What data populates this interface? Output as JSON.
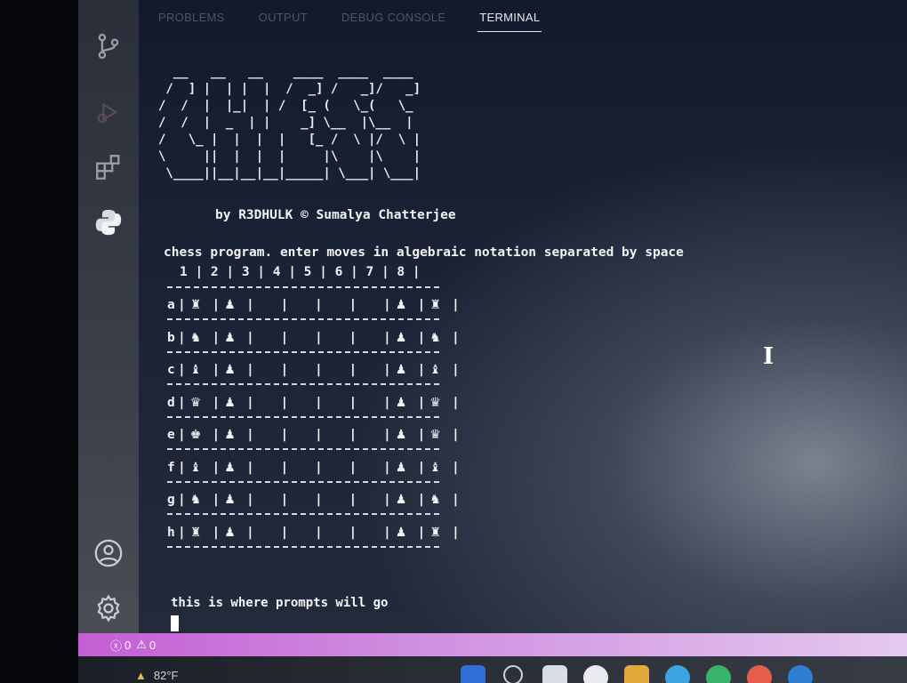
{
  "panel": {
    "tabs": [
      {
        "label": "PROBLEMS",
        "active": false
      },
      {
        "label": "OUTPUT",
        "active": false
      },
      {
        "label": "DEBUG CONSOLE",
        "active": false
      },
      {
        "label": "TERMINAL",
        "active": true
      }
    ]
  },
  "activity_bar": {
    "icons": [
      "source-control-icon",
      "run-debug-icon",
      "extensions-icon",
      "python-icon",
      "account-icon",
      "settings-gear-icon"
    ]
  },
  "terminal": {
    "ascii_logo": "  __   __   __    ____  ____  ____\n /  ] |  | |  |  /  _] /   _]/   _]\n/  /  |  |_|  | /  [_ (   \\_(   \\_\n/  /  |  _  | |    _] \\__  |\\__  |\n/   \\_ |  |  |  |   [_ /  \\ |/  \\ |\n\\     ||  |  |  |     |\\    |\\    |\n \\____||__|__|__|_____| \\___| \\___|",
    "credit": "by R3DHULK © Sumalya Chatterjee",
    "intro": "chess program. enter moves in algebraic notation separated by space",
    "header": "1 | 2 | 3 | 4 | 5 | 6 | 7 | 8 |",
    "separator": "---------------------------------",
    "rows": [
      {
        "label": "a",
        "cells": [
          "♜",
          "♟",
          "",
          "",
          "",
          "",
          "♟",
          "♜"
        ]
      },
      {
        "label": "b",
        "cells": [
          "♞",
          "♟",
          "",
          "",
          "",
          "",
          "♟",
          "♞"
        ]
      },
      {
        "label": "c",
        "cells": [
          "♝",
          "♟",
          "",
          "",
          "",
          "",
          "♟",
          "♝"
        ]
      },
      {
        "label": "d",
        "cells": [
          "♛",
          "♟",
          "",
          "",
          "",
          "",
          "♟",
          "♛"
        ]
      },
      {
        "label": "e",
        "cells": [
          "♚",
          "♟",
          "",
          "",
          "",
          "",
          "♟",
          "♛"
        ]
      },
      {
        "label": "f",
        "cells": [
          "♝",
          "♟",
          "",
          "",
          "",
          "",
          "♟",
          "♝"
        ]
      },
      {
        "label": "g",
        "cells": [
          "♞",
          "♟",
          "",
          "",
          "",
          "",
          "♟",
          "♞"
        ]
      },
      {
        "label": "h",
        "cells": [
          "♜",
          "♟",
          "",
          "",
          "",
          "",
          "♟",
          "♜"
        ]
      }
    ],
    "prompt": "this is where prompts will go"
  },
  "status_bar": {
    "errors": "0",
    "warnings": "0"
  },
  "taskbar": {
    "temperature": "82°F"
  },
  "colors": {
    "status_bar": "#c45ed4",
    "terminal_text": "#f2f3f5",
    "active_tab": "#e8e9ec"
  }
}
